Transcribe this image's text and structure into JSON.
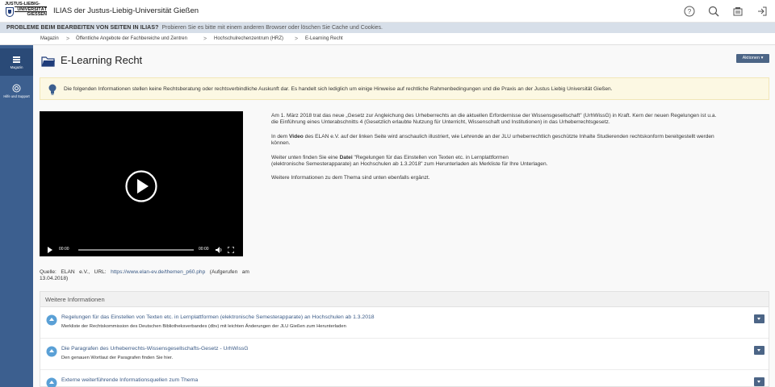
{
  "header": {
    "logo_line1": "JUSTUS-LIEBIG-",
    "logo_line2": "UNIVERSITÄT",
    "logo_line3": "GIESSEN",
    "title": "ILIAS der Justus-Liebig-Universität Gießen",
    "icons": [
      "help-icon",
      "search-icon",
      "notifications-icon",
      "logout-icon"
    ]
  },
  "warning": {
    "label": "PROBLEME BEIM BEARBEITEN VON SEITEN IN ILIAS?",
    "message": "Probieren Sie es bitte mit einem anderen Browser oder löschen Sie Cache und Cookies."
  },
  "breadcrumb": [
    "Magazin",
    "Öffentliche Angebote der Fachbereiche und Zentren",
    "Hochschulrechenzentrum (HRZ)",
    "E-Learning Recht"
  ],
  "mainbar": {
    "items": [
      {
        "label": "Magazin",
        "icon": "repository-icon"
      },
      {
        "label": "Hilfe und Support",
        "icon": "help-support-icon"
      }
    ]
  },
  "page": {
    "title": "E-Learning Recht",
    "actions_label": "Aktionen ▾",
    "info": "Die folgenden Informationen stellen keine Rechtsberatung oder rechtsverbindliche Auskunft dar. Es handelt sich lediglich um einige Hinweise auf rechtliche Rahmenbedingungen und die Praxis an der Justus Liebig Universität Gießen."
  },
  "video": {
    "time_current": "00:00",
    "time_total": "00:00"
  },
  "text": {
    "p1_line1": "Am 1. März 2018 trat das  neue „Gesetz zur Angleichung des Urheberrechts an die aktuellen Erfordernisse der Wissensgesellschaft\" (UrhWissG) in Kraft. Kern der neuen Regelungen ist u.a.",
    "p1_line2": "die Einführung eines Unterabschnitts 4 (Gesetzlich erlaubte Nutzung für Unterricht, Wissenschaft und Institutionen) in das Urheberrechtsgesetz.",
    "p2_pre": "In dem ",
    "p2_bold": "Video",
    "p2_post": " des ELAN e.V. auf der linken Seite wird anschaulich illustriert, wie Lehrende an der JLU urheberrechtlich geschützte Inhalte Studierenden rechtskonform bereitgestellt werden",
    "p2_line2": "können.",
    "p3_pre": "Weiter unten finden Sie eine ",
    "p3_bold": "Datei",
    "p3_post": " \"Regelungen für das Einstellen von Texten etc. in Lernplattformen",
    "p3_line2": "(elektronische Semesterapparate) an Hochschulen ab 1.3.2018\" zum Herunterladen als Merkliste für Ihre Unterlagen.",
    "p4": "Weitere Informationen zu dem Thema sind unten ebenfalls ergänzt."
  },
  "source": {
    "prefix": "Quelle:   ELAN   e.V.,   URL:   ",
    "url": "https://www.elan-ev.de/themen_p60.php",
    "suffix": "   (Aufgerufen   am",
    "date": "13.04.2018)"
  },
  "panel": {
    "title": "Weitere Informationen",
    "rows": [
      {
        "title": "Regelungen für das Einstellen von Texten etc. in Lernplattformen (elektronische Semesterapparate) an Hochschulen ab 1.3.2018",
        "desc": "Merkliste der Rechtskommission des Deutschen Bibliotheksverbandes (dbv) mit leichten Änderungen der JLU Gießen zum Herunterladen"
      },
      {
        "title": "Die Paragrafen des Urheberrechts-Wissensgesellschafts-Gesetz - UrhWissG",
        "desc": "Den genauen Wortlaut der Paragrafen finden Sie hier."
      },
      {
        "title": "Externe weiterführende Informationsquellen zum Thema",
        "desc": ""
      }
    ]
  }
}
